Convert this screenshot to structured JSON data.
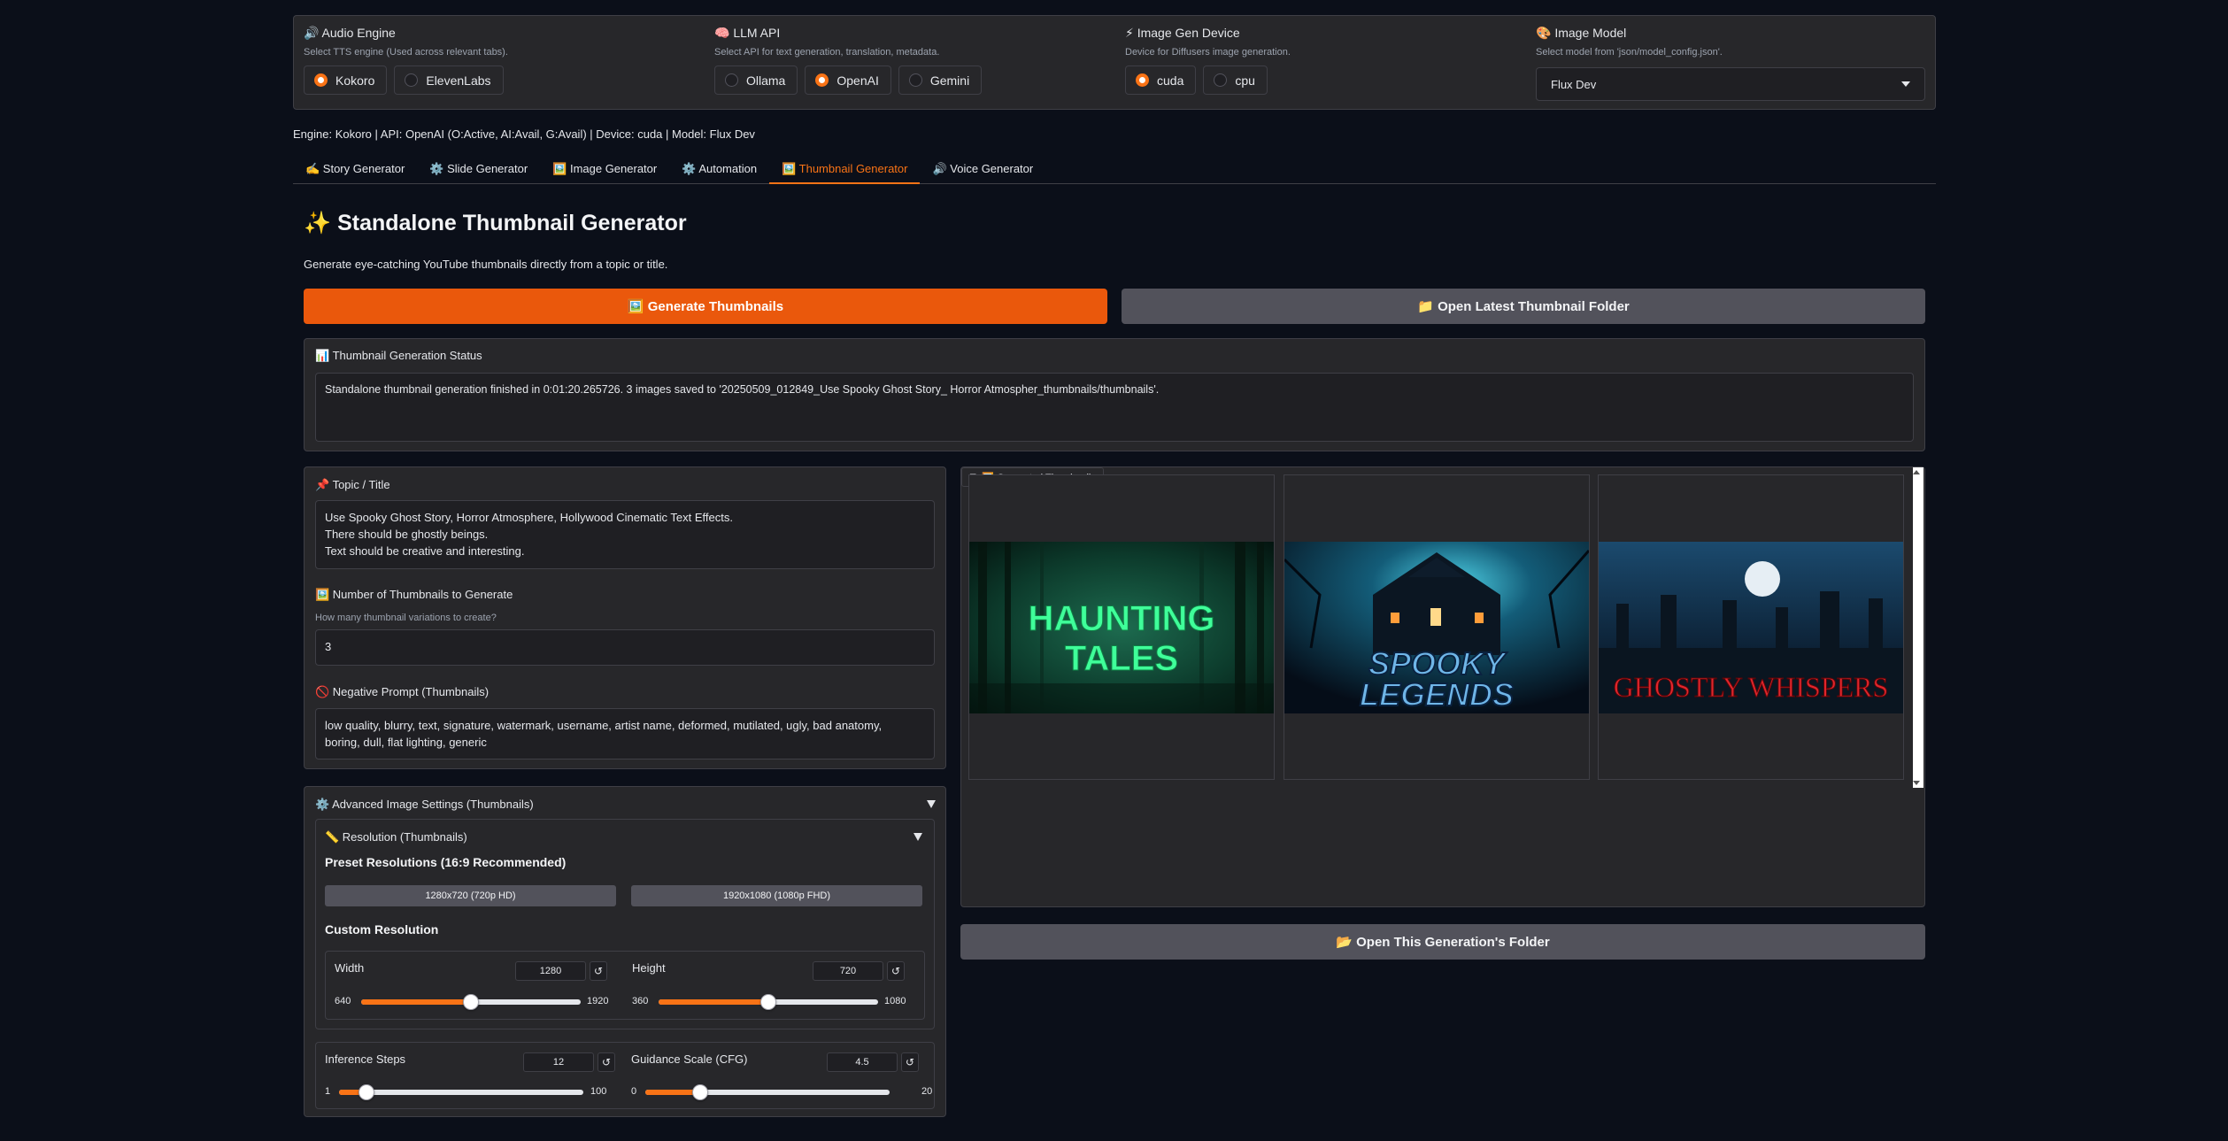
{
  "config": {
    "audio": {
      "title": "🔊 Audio Engine",
      "subtitle": "Select TTS engine (Used across relevant tabs).",
      "options": [
        "Kokoro",
        "ElevenLabs"
      ],
      "selected": "Kokoro"
    },
    "llm": {
      "title": "🧠 LLM API",
      "subtitle": "Select API for text generation, translation, metadata.",
      "options": [
        "Ollama",
        "OpenAI",
        "Gemini"
      ],
      "selected": "OpenAI"
    },
    "device": {
      "title": "⚡ Image Gen Device",
      "subtitle": "Device for Diffusers image generation.",
      "options": [
        "cuda",
        "cpu"
      ],
      "selected": "cuda"
    },
    "model": {
      "title": "🎨 Image Model",
      "subtitle": "Select model from 'json/model_config.json'.",
      "value": "Flux Dev"
    }
  },
  "status_line": "Engine: Kokoro | API: OpenAI (O:Active, AI:Avail, G:Avail) | Device: cuda | Model: Flux Dev",
  "tabs": [
    {
      "label": "✍️ Story Generator",
      "active": false
    },
    {
      "label": "⚙️ Slide Generator",
      "active": false
    },
    {
      "label": "🖼️ Image Generator",
      "active": false
    },
    {
      "label": "⚙️ Automation",
      "active": false
    },
    {
      "label": "🖼️ Thumbnail Generator",
      "active": true
    },
    {
      "label": "🔊 Voice Generator",
      "active": false
    }
  ],
  "page": {
    "title": "✨ Standalone Thumbnail Generator",
    "description": "Generate eye-catching YouTube thumbnails directly from a topic or title."
  },
  "buttons": {
    "generate": "🖼️ Generate Thumbnails",
    "open_latest": "📁 Open Latest Thumbnail Folder",
    "open_generation": "📂 Open This Generation's Folder"
  },
  "status_box": {
    "label": "📊 Thumbnail Generation Status",
    "text": "Standalone thumbnail generation finished in 0:01:20.265726. 3 images saved to '20250509_012849_Use Spooky Ghost Story_ Horror Atmospher_thumbnails/thumbnails'."
  },
  "topic": {
    "label": "📌 Topic / Title",
    "value": "Use Spooky Ghost Story, Horror Atmosphere, Hollywood Cinematic Text Effects.\nThere should be ghostly beings.\nText should be creative and interesting."
  },
  "num_thumbs": {
    "label": "🖼️ Number of Thumbnails to Generate",
    "sublabel": "How many thumbnail variations to create?",
    "value": "3"
  },
  "negative": {
    "label": "🚫 Negative Prompt (Thumbnails)",
    "value": "low quality, blurry, text, signature, watermark, username, artist name, deformed, mutilated, ugly, bad anatomy,\nboring, dull, flat lighting, generic"
  },
  "gallery": {
    "label": "🖼️ Generated Thumbnails",
    "images": [
      {
        "text_line1": "HAUNTING",
        "text_line2": "TALES"
      },
      {
        "text_line1": "SPOOKY",
        "text_line2": "LEGENDS"
      },
      {
        "text_line1": "GHOSTLY WHISPERS",
        "text_line2": ""
      }
    ]
  },
  "advanced": {
    "label": "⚙️ Advanced Image Settings (Thumbnails)",
    "resolution_label": "📏 Resolution (Thumbnails)",
    "preset_heading": "Preset Resolutions (16:9 Recommended)",
    "presets": [
      "1280x720 (720p HD)",
      "1920x1080 (1080p FHD)"
    ],
    "custom_heading": "Custom Resolution",
    "width": {
      "label": "Width",
      "value": "1280",
      "min": "640",
      "max": "1920",
      "level": 0.5
    },
    "height": {
      "label": "Height",
      "value": "720",
      "min": "360",
      "max": "1080",
      "level": 0.5
    },
    "steps": {
      "label": "Inference Steps",
      "value": "12",
      "min": "1",
      "max": "100",
      "level": 0.111
    },
    "cfg": {
      "label": "Guidance Scale (CFG)",
      "value": "4.5",
      "min": "0",
      "max": "20",
      "level": 0.225
    },
    "reset_glyph": "↺"
  }
}
